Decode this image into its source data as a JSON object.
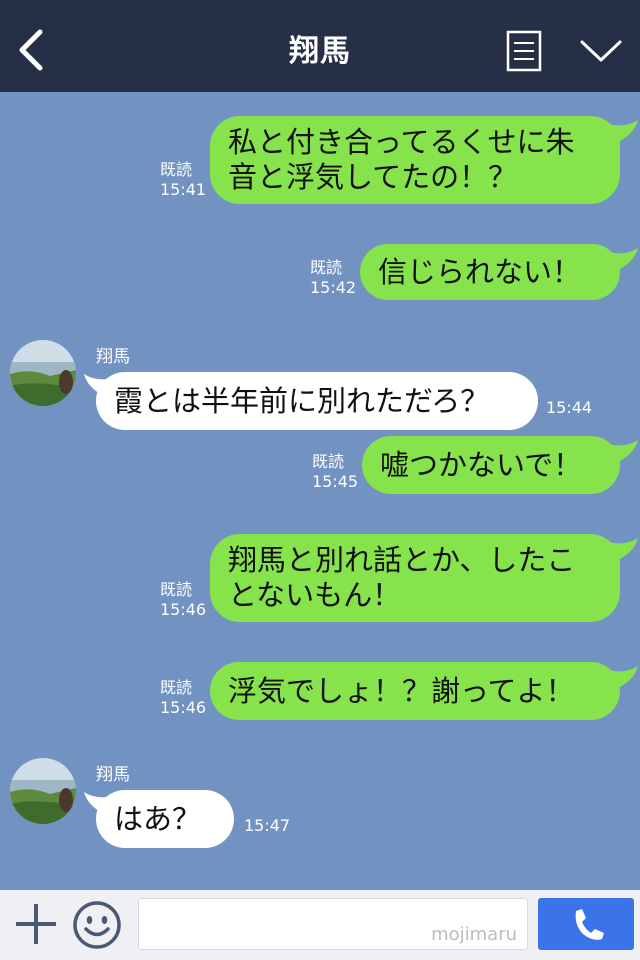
{
  "header": {
    "title": "翔馬"
  },
  "messages": [
    {
      "dir": "out",
      "text": "私と付き合ってるくせに朱音と浮気してたの！？",
      "read": "既読",
      "time": "15:41"
    },
    {
      "dir": "out",
      "text": "信じられない！",
      "read": "既読",
      "time": "15:42"
    },
    {
      "dir": "in",
      "sender": "翔馬",
      "text": "霞とは半年前に別れただろ？",
      "time": "15:44"
    },
    {
      "dir": "out",
      "text": "嘘つかないで！",
      "read": "既読",
      "time": "15:45"
    },
    {
      "dir": "out",
      "text": "翔馬と別れ話とか、したことないもん！",
      "read": "既読",
      "time": "15:46"
    },
    {
      "dir": "out",
      "text": "浮気でしょ！？謝ってよ！",
      "read": "既読",
      "time": "15:46"
    },
    {
      "dir": "in",
      "sender": "翔馬",
      "text": "はあ？",
      "time": "15:47"
    }
  ],
  "input": {
    "watermark": "mojimaru"
  },
  "icons": {
    "back": "chevron-left-icon",
    "menu": "notes-icon",
    "collapse": "chevron-down-icon",
    "add": "plus-icon",
    "emoji": "smiley-icon",
    "call": "phone-icon"
  },
  "colors": {
    "header_bg": "#252f45",
    "chat_bg": "#7293c2",
    "outgoing_bubble": "#87e34b",
    "incoming_bubble": "#ffffff",
    "call_button": "#3b74e8"
  }
}
